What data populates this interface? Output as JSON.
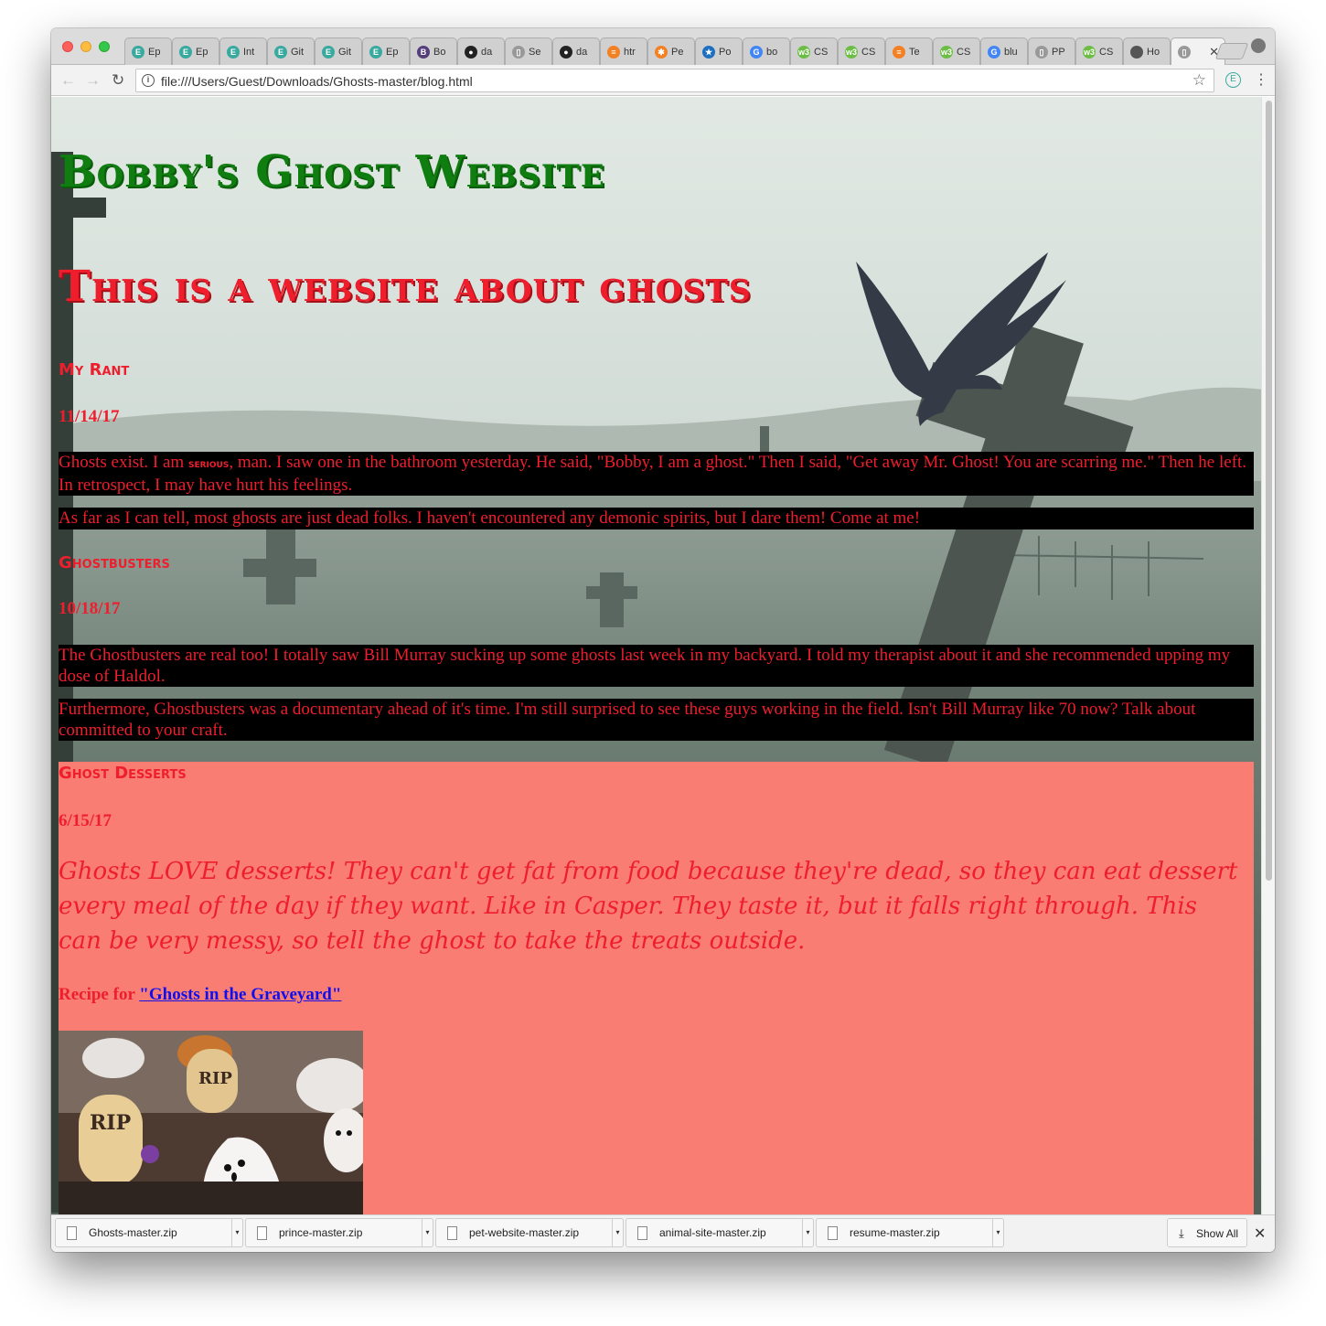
{
  "browser": {
    "tabs": [
      {
        "label": "Ep",
        "icon": "e-icon",
        "color": "#3aa99f"
      },
      {
        "label": "Ep",
        "icon": "e-icon",
        "color": "#3aa99f"
      },
      {
        "label": "Int",
        "icon": "e-icon",
        "color": "#3aa99f"
      },
      {
        "label": "Git",
        "icon": "e-icon",
        "color": "#3aa99f"
      },
      {
        "label": "Git",
        "icon": "e-icon",
        "color": "#3aa99f"
      },
      {
        "label": "Ep",
        "icon": "e-icon",
        "color": "#3aa99f"
      },
      {
        "label": "Bo",
        "icon": "bootstrap-icon",
        "color": "#563d7c"
      },
      {
        "label": "da",
        "icon": "github-icon",
        "color": "#222222"
      },
      {
        "label": "Se",
        "icon": "page-icon",
        "color": "#999999"
      },
      {
        "label": "da",
        "icon": "github-icon",
        "color": "#222222"
      },
      {
        "label": "htr",
        "icon": "stackoverflow-icon",
        "color": "#f48024"
      },
      {
        "label": "Pe",
        "icon": "asterisk-icon",
        "color": "#f48024"
      },
      {
        "label": "Po",
        "icon": "star-icon",
        "color": "#1e6fbf"
      },
      {
        "label": "bo",
        "icon": "google-icon",
        "color": "#4285f4"
      },
      {
        "label": "CS",
        "icon": "w3-icon",
        "color": "#6cbd45"
      },
      {
        "label": "CS",
        "icon": "w3-icon",
        "color": "#6cbd45"
      },
      {
        "label": "Te",
        "icon": "stackoverflow-icon",
        "color": "#f48024"
      },
      {
        "label": "CS",
        "icon": "w3-icon",
        "color": "#6cbd45"
      },
      {
        "label": "blu",
        "icon": "google-icon",
        "color": "#4285f4"
      },
      {
        "label": "PP",
        "icon": "page-icon",
        "color": "#999999"
      },
      {
        "label": "CS",
        "icon": "w3-icon",
        "color": "#6cbd45"
      },
      {
        "label": "Ho",
        "icon": "apple-icon",
        "color": "#555555"
      },
      {
        "label": "",
        "icon": "page-icon",
        "color": "#999999"
      }
    ],
    "url": "file:///Users/Guest/Downloads/Ghosts-master/blog.html"
  },
  "page": {
    "title": "Bobby's Ghost Website",
    "subtitle": "This is a website about ghosts",
    "posts": [
      {
        "heading": "My Rant",
        "date": "11/14/17",
        "p1_before": "Ghosts exist. I am ",
        "p1_emph": "serious",
        "p1_after": ", man. I saw one in the bathroom yesterday. He said, \"Bobby, I am a ghost.\" Then I said, \"Get away Mr. Ghost! You are scarring me.\" Then he left. In retrospect, I may have hurt his feelings.",
        "p2": "As far as I can tell, most ghosts are just dead folks. I haven't encountered any demonic spirits, but I dare them! Come at me!"
      },
      {
        "heading": "Ghostbusters",
        "date": "10/18/17",
        "p1": "The Ghostbusters are real too! I totally saw Bill Murray sucking up some ghosts last week in my backyard. I told my therapist about it and she recommended upping my dose of Haldol.",
        "p2": "Furthermore, Ghostbusters was a documentary ahead of it's time. I'm still surprised to see these guys working in the field. Isn't Bill Murray like 70 now? Talk about committed to your craft."
      },
      {
        "heading": "Ghost Desserts",
        "date": "6/15/17",
        "p1": "Ghosts LOVE desserts! They can't get fat from food because they're dead, so they can eat dessert every meal of the day if they want. Like in Casper. They taste it, but it falls right through. This can be very messy, so tell the ghost to take the treats outside.",
        "recipe_prefix": "Recipe for ",
        "recipe_link": "\"Ghosts in the Graveyard\""
      }
    ],
    "image_tags": [
      "RIP",
      "RIP"
    ]
  },
  "downloads": {
    "items": [
      "Ghosts-master.zip",
      "prince-master.zip",
      "pet-website-master.zip",
      "animal-site-master.zip",
      "resume-master.zip"
    ],
    "show_all": "Show All"
  },
  "colors": {
    "title_green": "#0f7d0f",
    "accent_red": "#ee1e2d",
    "salmon": "#f97d73",
    "link_blue": "#1010ee"
  }
}
